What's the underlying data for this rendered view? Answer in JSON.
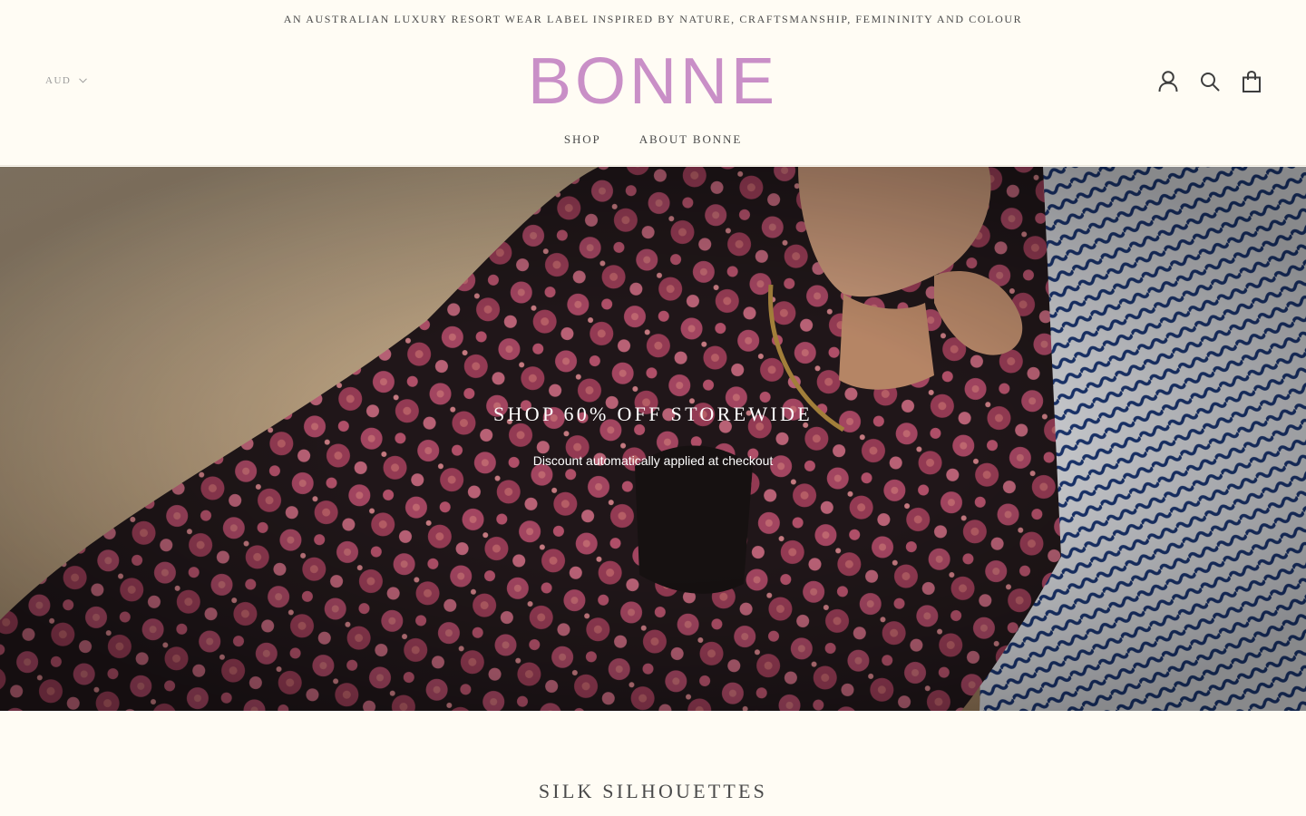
{
  "announcement": {
    "text": "AN AUSTRALIAN LUXURY RESORT WEAR LABEL INSPIRED BY NATURE, CRAFTSMANSHIP, FEMININITY AND COLOUR"
  },
  "header": {
    "currency": "AUD",
    "logo": "BONNE",
    "icons": [
      "account-icon",
      "search-icon",
      "bag-icon"
    ],
    "nav": [
      {
        "label": "SHOP"
      },
      {
        "label": "ABOUT BONNE"
      }
    ]
  },
  "hero": {
    "title": "SHOP 60% OFF STOREWIDE",
    "subtitle": "Discount automatically applied at checkout"
  },
  "section": {
    "title": "SILK SILHOUETTES"
  },
  "colors": {
    "background": "#fffcf4",
    "logo": "#c98fc7",
    "text": "#4a4a4a"
  }
}
